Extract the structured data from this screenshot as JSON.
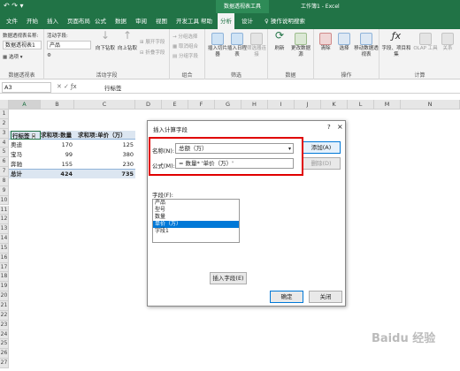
{
  "window": {
    "quick_access": "↶ ↷ ▾",
    "contextual_tab_group": "数据透视表工具",
    "title": "工作簿1 - Excel"
  },
  "tabs": [
    "文件",
    "开始",
    "插入",
    "页面布局",
    "公式",
    "数据",
    "审阅",
    "视图",
    "开发工具",
    "帮助",
    "分析",
    "设计"
  ],
  "tell_me": "操作说明搜索",
  "ribbon": {
    "pivot_name_label": "数据透视表名称:",
    "pivot_name_value": "数据透视表1",
    "options_label": "选项",
    "active_field_label": "活动字段:",
    "active_field_value": "产品",
    "drill_down": "向下钻取",
    "drill_up": "向上钻取",
    "expand_field": "展开字段",
    "collapse_field": "折叠字段",
    "group_selection": "分组选择",
    "ungroup": "取消组合",
    "group_field": "分组字段",
    "insert_slicer": "插入切片器",
    "insert_timeline": "插入日程表",
    "filter_connections": "筛选器连接",
    "refresh": "刷新",
    "change_source": "更改数据源",
    "clear": "清除",
    "select": "选择",
    "move_pivot": "移动数据透视表",
    "fields_items_sets": "字段、项目和集",
    "olap_tools": "OLAP 工具",
    "relationships": "关系",
    "groups": {
      "pivot": "数据透视表",
      "active_field": "活动字段",
      "group": "组合",
      "filter": "筛选",
      "data": "数据",
      "actions": "操作",
      "calculations": "计算"
    }
  },
  "formula_bar": {
    "name_box": "A3",
    "fx": "ƒx",
    "value": "行标签"
  },
  "columns": [
    "A",
    "B",
    "C",
    "D",
    "E",
    "F",
    "G",
    "H",
    "I",
    "J",
    "K",
    "L",
    "M",
    "N"
  ],
  "rows": [
    "1",
    "2",
    "3",
    "4",
    "5",
    "6",
    "7",
    "8",
    "9",
    "10",
    "11",
    "12",
    "13",
    "14",
    "15",
    "16",
    "17",
    "18",
    "19",
    "20",
    "21",
    "22",
    "23",
    "24",
    "25",
    "26",
    "27"
  ],
  "pivot_table": {
    "headers": [
      "行标签",
      "求和项:数量",
      "求和项:单价（万）"
    ],
    "rows": [
      [
        "奥迪",
        "170",
        "125"
      ],
      [
        "宝马",
        "99",
        "380"
      ],
      [
        "奔驰",
        "155",
        "230"
      ]
    ],
    "total": [
      "总计",
      "424",
      "735"
    ]
  },
  "dialog": {
    "title": "插入计算字段",
    "help": "?",
    "close": "×",
    "name_label": "名称(N):",
    "name_value": "总额（万）",
    "formula_label": "公式(M):",
    "formula_value": "= 数量* '单价（万）'",
    "add_button": "添加(A)",
    "delete_button": "删除(D)",
    "fields_label": "字段(F):",
    "fields": [
      "产品",
      "型号",
      "数量",
      "单价（万）",
      "字段1"
    ],
    "selected_field_index": 3,
    "insert_field_button": "插入字段(E)",
    "ok_button": "确定",
    "close_button": "关闭"
  },
  "watermark": "Baidu 经验",
  "colors": {
    "excel_green": "#217346",
    "highlight_red": "#e00000",
    "selection_blue": "#0078d7",
    "pivot_header_blue": "#dce6f1"
  }
}
